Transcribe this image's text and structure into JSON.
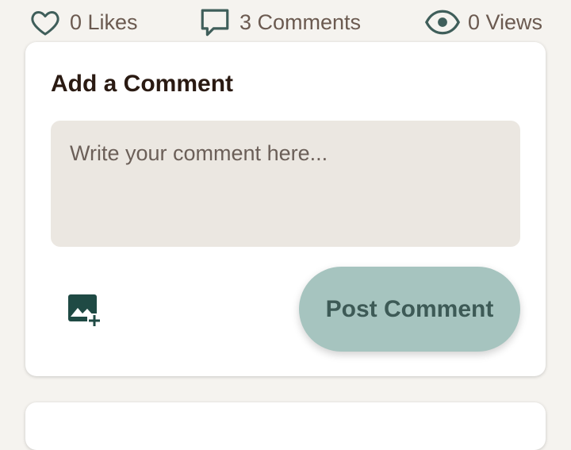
{
  "stats": {
    "likes": {
      "count_label": "0 Likes",
      "icon": "heart-outline-icon"
    },
    "comments": {
      "count_label": "3 Comments",
      "icon": "comment-bubble-icon"
    },
    "views": {
      "count_label": "0 Views",
      "icon": "eye-icon"
    }
  },
  "comment_form": {
    "title": "Add a Comment",
    "placeholder": "Write your comment here...",
    "value": "",
    "image_button_icon": "add-photo-icon",
    "submit_label": "Post Comment"
  },
  "colors": {
    "accent": "#a6c4bf",
    "accent_text": "#3d5a56",
    "icon_dark": "#1f4a44",
    "stat_text": "#6b5a50",
    "background": "#f5f3ef"
  }
}
